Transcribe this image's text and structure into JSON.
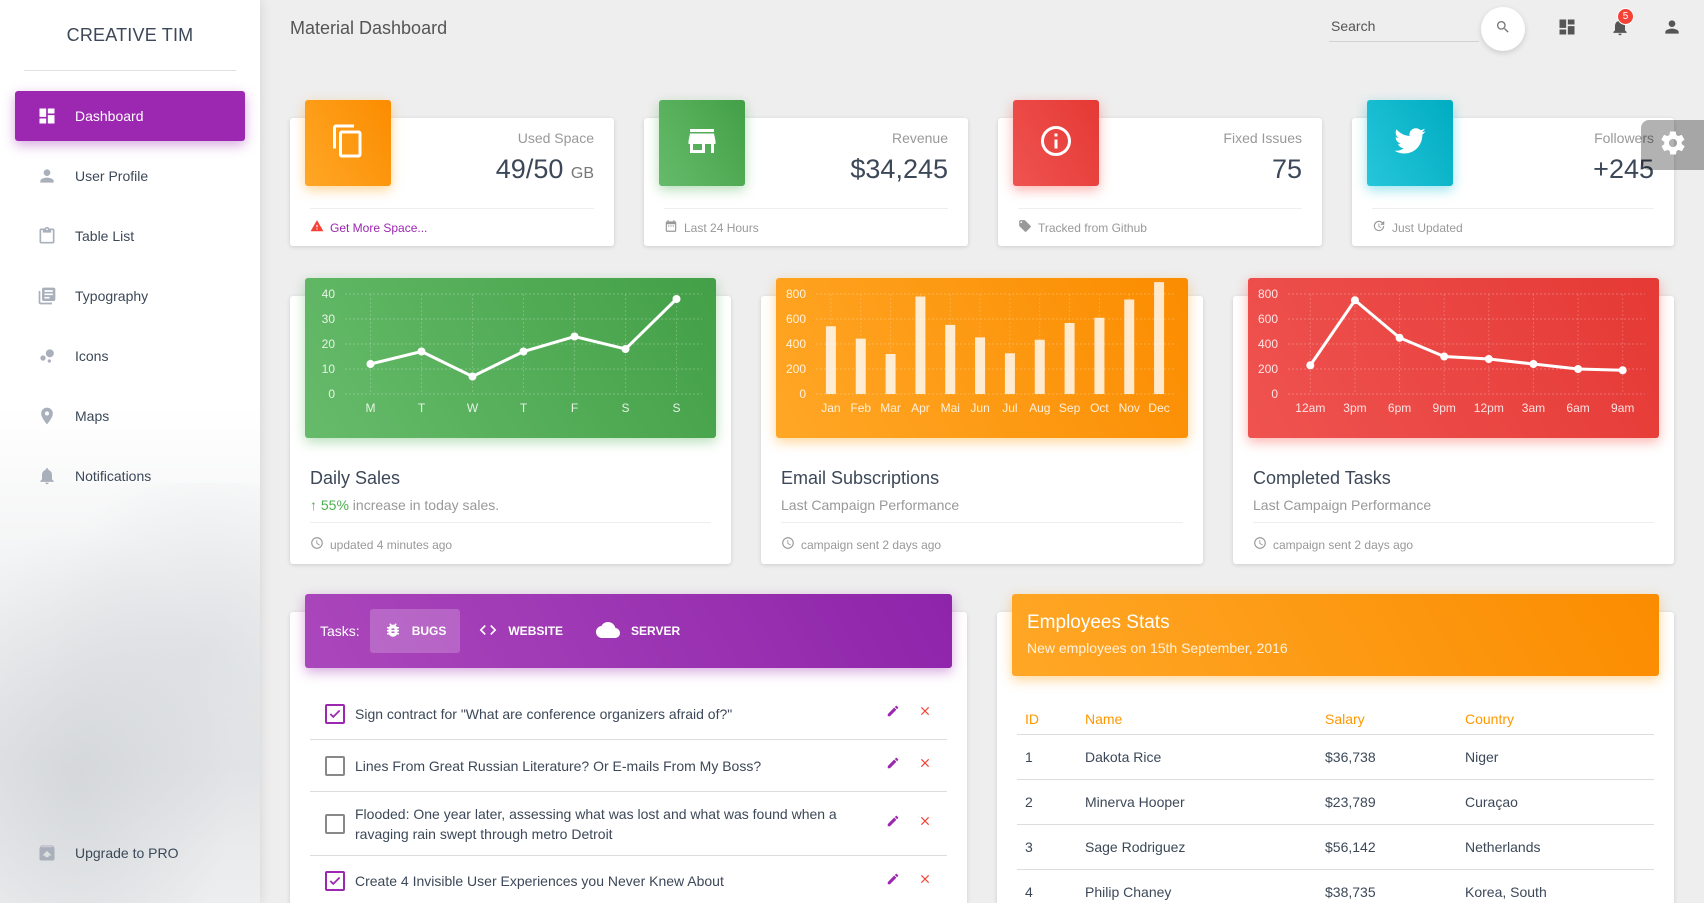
{
  "sidebar": {
    "brand": "CREATIVE TIM",
    "items": [
      {
        "label": "Dashboard",
        "icon": "dashboard-icon",
        "active": true
      },
      {
        "label": "User Profile",
        "icon": "person-icon"
      },
      {
        "label": "Table List",
        "icon": "clipboard-icon"
      },
      {
        "label": "Typography",
        "icon": "library-books-icon"
      },
      {
        "label": "Icons",
        "icon": "bubble-chart-icon"
      },
      {
        "label": "Maps",
        "icon": "location-pin-icon"
      },
      {
        "label": "Notifications",
        "icon": "bell-icon"
      }
    ],
    "upgrade": {
      "label": "Upgrade to PRO",
      "icon": "unarchive-icon"
    }
  },
  "topbar": {
    "title": "Material Dashboard",
    "search_placeholder": "Search",
    "notification_count": "5"
  },
  "stats": [
    {
      "category": "Used Space",
      "value": "49/50",
      "unit": "GB",
      "footer": "Get More Space...",
      "footer_icon": "warning-icon",
      "color": "#ff9800",
      "icon": "content-copy-icon"
    },
    {
      "category": "Revenue",
      "value": "$34,245",
      "unit": "",
      "footer": "Last 24 Hours",
      "footer_icon": "date-range-icon",
      "color": "#4caf50",
      "icon": "store-icon"
    },
    {
      "category": "Fixed Issues",
      "value": "75",
      "unit": "",
      "footer": "Tracked from Github",
      "footer_icon": "local-offer-icon",
      "color": "#f44336",
      "icon": "info-outline-icon"
    },
    {
      "category": "Followers",
      "value": "+245",
      "unit": "",
      "footer": "Just Updated",
      "footer_icon": "update-icon",
      "color": "#00bcd4",
      "icon": "twitter-icon"
    }
  ],
  "charts": [
    {
      "title": "Daily Sales",
      "category_highlight": "55%",
      "category_rest": " increase in today sales.",
      "footer": "updated 4 minutes ago",
      "color": "#4caf50"
    },
    {
      "title": "Email Subscriptions",
      "category_highlight": "",
      "category_rest": "Last Campaign Performance",
      "footer": "campaign sent 2 days ago",
      "color": "#ff9800"
    },
    {
      "title": "Completed Tasks",
      "category_highlight": "",
      "category_rest": "Last Campaign Performance",
      "footer": "campaign sent 2 days ago",
      "color": "#f44336"
    }
  ],
  "chart_data": [
    {
      "type": "line",
      "categories": [
        "M",
        "T",
        "W",
        "T",
        "F",
        "S",
        "S"
      ],
      "values": [
        12,
        17,
        7,
        17,
        23,
        18,
        38
      ],
      "ylim": [
        0,
        40
      ],
      "yticks": [
        0,
        10,
        20,
        30,
        40
      ],
      "grid": true
    },
    {
      "type": "bar",
      "categories": [
        "Jan",
        "Feb",
        "Mar",
        "Apr",
        "Mai",
        "Jun",
        "Jul",
        "Aug",
        "Sep",
        "Oct",
        "Nov",
        "Dec"
      ],
      "values": [
        542,
        443,
        320,
        780,
        553,
        453,
        326,
        434,
        568,
        610,
        756,
        895
      ],
      "ylim": [
        0,
        800
      ],
      "yticks": [
        0,
        200,
        400,
        600,
        800
      ],
      "grid": true
    },
    {
      "type": "line",
      "categories": [
        "12am",
        "3pm",
        "6pm",
        "9pm",
        "12pm",
        "3am",
        "6am",
        "9am"
      ],
      "values": [
        230,
        750,
        450,
        300,
        280,
        240,
        200,
        190
      ],
      "ylim": [
        0,
        800
      ],
      "yticks": [
        0,
        200,
        400,
        600,
        800
      ],
      "grid": true
    }
  ],
  "tasks": {
    "label": "Tasks:",
    "tabs": [
      {
        "label": "BUGS",
        "icon": "bug-icon",
        "active": true
      },
      {
        "label": "WEBSITE",
        "icon": "code-icon"
      },
      {
        "label": "SERVER",
        "icon": "cloud-icon"
      }
    ],
    "items": [
      {
        "text": "Sign contract for \"What are conference organizers afraid of?\"",
        "checked": true
      },
      {
        "text": "Lines From Great Russian Literature? Or E-mails From My Boss?",
        "checked": false
      },
      {
        "text": "Flooded: One year later, assessing what was lost and what was found when a ravaging rain swept through metro Detroit",
        "checked": false
      },
      {
        "text": "Create 4 Invisible User Experiences you Never Knew About",
        "checked": true
      }
    ]
  },
  "employees": {
    "title": "Employees Stats",
    "subtitle": "New employees on 15th September, 2016",
    "columns": [
      "ID",
      "Name",
      "Salary",
      "Country"
    ],
    "rows": [
      [
        "1",
        "Dakota Rice",
        "$36,738",
        "Niger"
      ],
      [
        "2",
        "Minerva Hooper",
        "$23,789",
        "Curaçao"
      ],
      [
        "3",
        "Sage Rodriguez",
        "$56,142",
        "Netherlands"
      ],
      [
        "4",
        "Philip Chaney",
        "$38,735",
        "Korea, South"
      ]
    ]
  },
  "colors": {
    "primary": "#9c27b0",
    "warning": "#ff9800",
    "success": "#4caf50",
    "danger": "#f44336",
    "info": "#00bcd4"
  }
}
